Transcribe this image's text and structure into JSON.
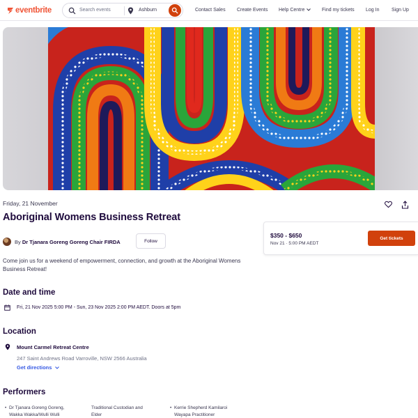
{
  "header": {
    "logo_text": "eventbrite",
    "search_placeholder": "Search events",
    "location": "Ashburn",
    "nav": {
      "contact_sales": "Contact Sales",
      "create_events": "Create Events",
      "help_centre": "Help Centre",
      "find_tickets": "Find my tickets",
      "log_in": "Log In",
      "sign_up": "Sign Up"
    }
  },
  "event": {
    "date_label": "Friday, 21 November",
    "title": "Aboriginal Womens Business Retreat",
    "organizer_prefix": "By",
    "organizer_name": "Dr Tjanara Goreng Goreng Chair FIRDA",
    "follow_label": "Follow",
    "description": "Come join us for a weekend of empowerment, connection, and growth at the Aboriginal Womens Business Retreat!"
  },
  "ticket": {
    "price_range": "$350 - $650",
    "datetime": "Nov 21 · 5:00 PM AEDT",
    "cta_label": "Get tickets"
  },
  "date_time": {
    "heading": "Date and time",
    "text": "Fri, 21 Nov 2025 5:00 PM - Sun, 23 Nov 2025 2:00 PM AEDT. Doors at 5pm"
  },
  "location": {
    "heading": "Location",
    "venue": "Mount Carmel Retreat Centre",
    "address": "247 Saint Andrews Road Varroville, NSW 2566 Australia",
    "directions_label": "Get directions"
  },
  "performers": {
    "heading": "Performers",
    "items": [
      {
        "line1": "Dr Tjanara Goreng Goreng,",
        "line2": "Wakka Wakka/Wulli Wulli"
      },
      {
        "line1": "Traditional Custodian and",
        "line2": "Elder"
      },
      {
        "line1": "Kerrie Shepherd Kamilaroi",
        "line2": "Wayapa Practitioner"
      }
    ]
  },
  "icons": {
    "search": "search-icon",
    "location": "map-pin-icon",
    "like": "heart-icon",
    "share": "share-icon",
    "calendar": "calendar-icon"
  },
  "colors": {
    "brand": "#f05537",
    "cta": "#d1410c",
    "link": "#3659e3",
    "heading": "#1e0a3c"
  }
}
